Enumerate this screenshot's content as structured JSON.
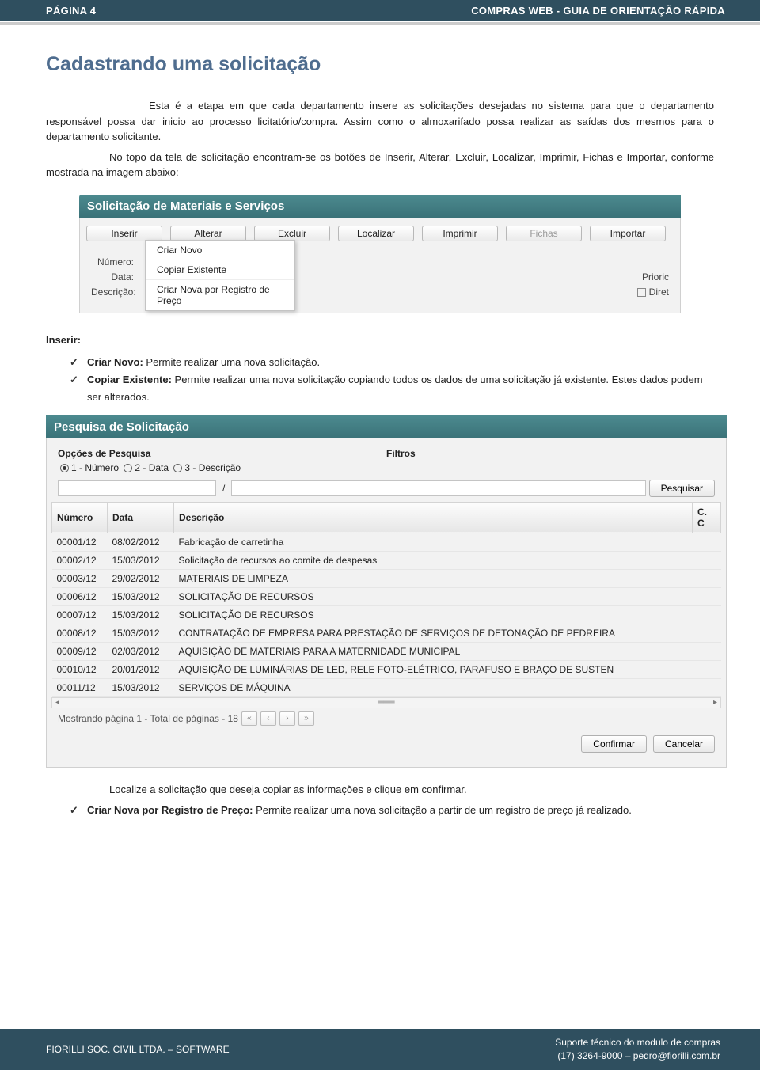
{
  "header": {
    "page_label": "PÁGINA 4",
    "doc_title": "COMPRAS WEB - GUIA DE ORIENTAÇÃO RÁPIDA"
  },
  "title": "Cadastrando uma solicitação",
  "para1": "Esta é a etapa em que cada departamento insere as solicitações desejadas no sistema para que o departamento responsável possa dar inicio ao processo licitatório/compra. Assim como o almoxarifado possa realizar as saídas dos mesmos para o departamento solicitante.",
  "para2": "No topo da tela de solicitação encontram-se os botões de Inserir, Alterar, Excluir, Localizar, Imprimir, Fichas e Importar, conforme mostrada na imagem abaixo:",
  "win1": {
    "title": "Solicitação de Materiais e Serviços",
    "tabs": [
      "Inserir",
      "Alterar",
      "Excluir",
      "Localizar",
      "Imprimir",
      "Fichas",
      "Importar"
    ],
    "dropdown": [
      "Criar Novo",
      "Copiar Existente",
      "Criar Nova por Registro de Preço"
    ],
    "labels": {
      "numero": "Número:",
      "data": "Data:",
      "descricao": "Descrição:",
      "prioric": "Prioric",
      "diret": "Diret"
    }
  },
  "inserir_head": "Inserir:",
  "bullets1": [
    {
      "label": "Criar Novo:",
      "text": " Permite realizar uma nova solicitação."
    },
    {
      "label": "Copiar Existente:",
      "text": " Permite realizar uma nova solicitação copiando todos os dados de uma solicitação já existente. Estes dados podem ser alterados."
    }
  ],
  "win2": {
    "title": "Pesquisa de Solicitação",
    "opts_head": "Opções de Pesquisa",
    "filtros": "Filtros",
    "radios": [
      "1 - Número",
      "2 - Data",
      "3 - Descrição"
    ],
    "search_btn": "Pesquisar",
    "cols": [
      "Número",
      "Data",
      "Descrição",
      "C. C"
    ],
    "rows": [
      [
        "00001/12",
        "08/02/2012",
        "Fabricação de carretinha"
      ],
      [
        "00002/12",
        "15/03/2012",
        "Solicitação de recursos ao comite de despesas"
      ],
      [
        "00003/12",
        "29/02/2012",
        "MATERIAIS DE LIMPEZA"
      ],
      [
        "00006/12",
        "15/03/2012",
        "SOLICITAÇÃO DE RECURSOS"
      ],
      [
        "00007/12",
        "15/03/2012",
        "SOLICITAÇÃO DE RECURSOS"
      ],
      [
        "00008/12",
        "15/03/2012",
        "CONTRATAÇÃO DE EMPRESA PARA PRESTAÇÃO DE SERVIÇOS DE DETONAÇÃO DE PEDREIRA"
      ],
      [
        "00009/12",
        "02/03/2012",
        "AQUISIÇÃO DE MATERIAIS PARA A MATERNIDADE MUNICIPAL"
      ],
      [
        "00010/12",
        "20/01/2012",
        "AQUISIÇÃO DE LUMINÁRIAS DE LED, RELE FOTO-ELÉTRICO, PARAFUSO E BRAÇO DE SUSTEN"
      ],
      [
        "00011/12",
        "15/03/2012",
        "SERVIÇOS DE MÁQUINA"
      ]
    ],
    "pager": "Mostrando página 1 - Total de páginas - 18",
    "confirm": "Confirmar",
    "cancel": "Cancelar"
  },
  "para3": "Localize a solicitação que deseja copiar as informações e clique em confirmar.",
  "bullets2": [
    {
      "label": "Criar Nova por Registro de Preço:",
      "text": " Permite realizar uma nova solicitação a partir de um registro de preço já realizado."
    }
  ],
  "footer": {
    "left": "FIORILLI SOC. CIVIL LTDA. – SOFTWARE",
    "right1": "Suporte técnico do modulo de compras",
    "right2": "(17) 3264-9000 – pedro@fiorilli.com.br"
  }
}
